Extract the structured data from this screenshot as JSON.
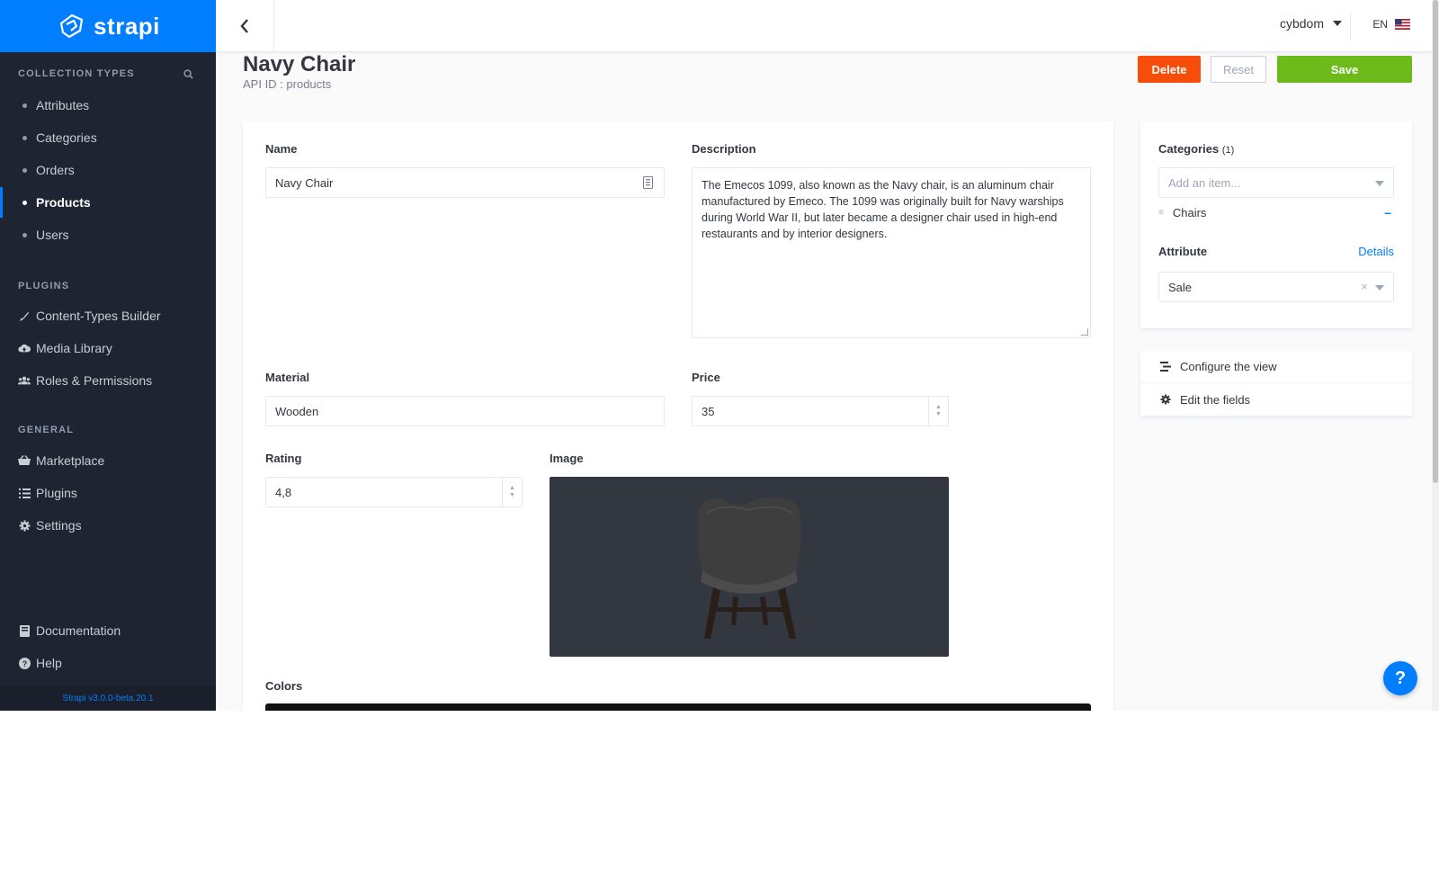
{
  "brand": {
    "name": "strapi"
  },
  "sidebar": {
    "collection_types_heading": "COLLECTION TYPES",
    "collection_types": [
      {
        "label": "Attributes",
        "active": false
      },
      {
        "label": "Categories",
        "active": false
      },
      {
        "label": "Orders",
        "active": false
      },
      {
        "label": "Products",
        "active": true
      },
      {
        "label": "Users",
        "active": false
      }
    ],
    "plugins_heading": "PLUGINS",
    "plugins": [
      {
        "label": "Content-Types Builder",
        "icon": "brush-icon"
      },
      {
        "label": "Media Library",
        "icon": "cloud-upload-icon"
      },
      {
        "label": "Roles & Permissions",
        "icon": "users-icon"
      }
    ],
    "general_heading": "GENERAL",
    "general": [
      {
        "label": "Marketplace",
        "icon": "basket-icon"
      },
      {
        "label": "Plugins",
        "icon": "list-icon"
      },
      {
        "label": "Settings",
        "icon": "gear-icon"
      }
    ],
    "footer": [
      {
        "label": "Documentation",
        "icon": "book-icon"
      },
      {
        "label": "Help",
        "icon": "question-circle-icon"
      }
    ],
    "version": "Strapi v3.0.0-beta.20.1"
  },
  "header": {
    "user": "cybdom",
    "language": "EN"
  },
  "page": {
    "title": "Navy Chair",
    "api_id": "API ID : products",
    "delete_label": "Delete",
    "reset_label": "Reset",
    "save_label": "Save"
  },
  "form": {
    "name_label": "Name",
    "name_value": "Navy Chair",
    "description_label": "Description",
    "description_value": "The Emecos 1099, also known as the Navy chair, is an aluminum chair manufactured by Emeco. The 1099 was originally built for Navy warships during World War II, but later became a designer chair used in high-end restaurants and by interior designers.",
    "material_label": "Material",
    "material_value": "Wooden",
    "price_label": "Price",
    "price_value": "35",
    "rating_label": "Rating",
    "rating_value": "4,8",
    "image_label": "Image",
    "colors_label": "Colors"
  },
  "relations": {
    "categories_label": "Categories",
    "categories_count": "(1)",
    "categories_placeholder": "Add an item...",
    "categories_items": [
      "Chairs"
    ],
    "attribute_label": "Attribute",
    "attribute_details": "Details",
    "attribute_value": "Sale"
  },
  "configure": {
    "configure_view": "Configure the view",
    "edit_fields": "Edit the fields"
  },
  "help_button": "?",
  "colors": {
    "brand_blue": "#007eff",
    "delete_orange": "#f64d0a",
    "save_green": "#6dbb1a",
    "sidebar_bg": "#1f2433"
  }
}
